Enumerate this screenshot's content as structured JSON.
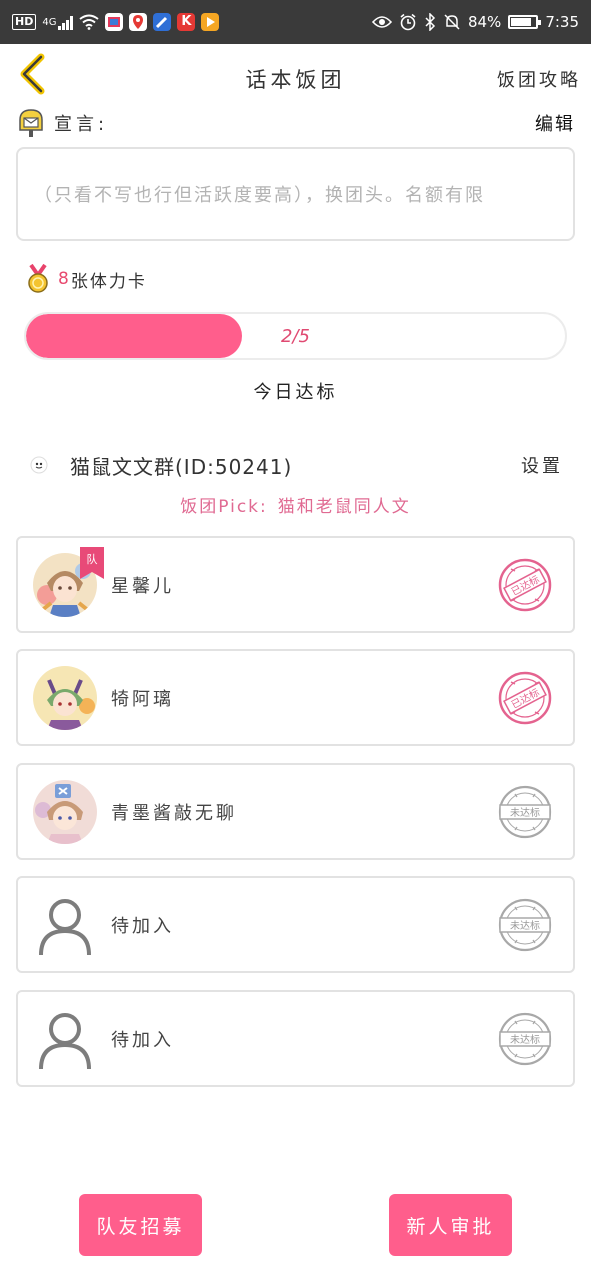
{
  "status_bar": {
    "hd": "HD",
    "net": "4G",
    "battery": "84%",
    "time": "7:35",
    "battery_level": 0.84
  },
  "header": {
    "title": "话本饭团",
    "strategy": "饭团攻略"
  },
  "declaration": {
    "label": "宣言:",
    "edit": "编辑",
    "text": "（只看不写也行但活跃度要高），换团头。名额有限"
  },
  "stamina": {
    "count": "8",
    "label": "张体力卡"
  },
  "progress": {
    "value": 2,
    "max": 5,
    "text": "2/5",
    "label": "今日达标"
  },
  "group": {
    "name": "猫鼠文文群(ID:50241)",
    "settings": "设置",
    "pick_label": "饭团Pick:",
    "pick_value": "猫和老鼠同人文"
  },
  "members": [
    {
      "name": "星馨儿",
      "status": "已达标",
      "captain": true,
      "captain_label": "队",
      "empty": false
    },
    {
      "name": "犄阿璃",
      "status": "已达标",
      "captain": false,
      "empty": false
    },
    {
      "name": "青墨酱敲无聊",
      "status": "未达标",
      "captain": false,
      "empty": false
    },
    {
      "name": "待加入",
      "status": "未达标",
      "captain": false,
      "empty": true
    },
    {
      "name": "待加入",
      "status": "未达标",
      "captain": false,
      "empty": true
    }
  ],
  "buttons": {
    "recruit": "队友招募",
    "approve": "新人审批"
  },
  "colors": {
    "accent": "#ff5e8c",
    "pick_text": "#e06a92",
    "stamp_done": "#e4638f",
    "stamp_pending": "#a8a8a8"
  },
  "icons": {
    "back": "chevron-left-icon",
    "mailbox": "mailbox-icon",
    "medal": "medal-icon",
    "group": "group-avatar-icon",
    "person": "person-placeholder-icon"
  }
}
